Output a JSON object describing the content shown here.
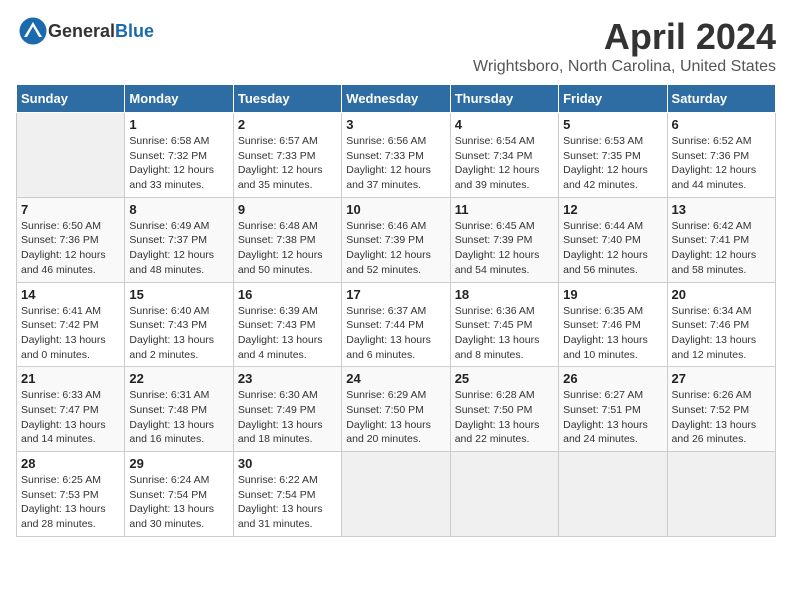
{
  "logo": {
    "general": "General",
    "blue": "Blue"
  },
  "header": {
    "month": "April 2024",
    "location": "Wrightsboro, North Carolina, United States"
  },
  "days_of_week": [
    "Sunday",
    "Monday",
    "Tuesday",
    "Wednesday",
    "Thursday",
    "Friday",
    "Saturday"
  ],
  "weeks": [
    [
      {
        "day": "",
        "info": ""
      },
      {
        "day": "1",
        "info": "Sunrise: 6:58 AM\nSunset: 7:32 PM\nDaylight: 12 hours\nand 33 minutes."
      },
      {
        "day": "2",
        "info": "Sunrise: 6:57 AM\nSunset: 7:33 PM\nDaylight: 12 hours\nand 35 minutes."
      },
      {
        "day": "3",
        "info": "Sunrise: 6:56 AM\nSunset: 7:33 PM\nDaylight: 12 hours\nand 37 minutes."
      },
      {
        "day": "4",
        "info": "Sunrise: 6:54 AM\nSunset: 7:34 PM\nDaylight: 12 hours\nand 39 minutes."
      },
      {
        "day": "5",
        "info": "Sunrise: 6:53 AM\nSunset: 7:35 PM\nDaylight: 12 hours\nand 42 minutes."
      },
      {
        "day": "6",
        "info": "Sunrise: 6:52 AM\nSunset: 7:36 PM\nDaylight: 12 hours\nand 44 minutes."
      }
    ],
    [
      {
        "day": "7",
        "info": "Sunrise: 6:50 AM\nSunset: 7:36 PM\nDaylight: 12 hours\nand 46 minutes."
      },
      {
        "day": "8",
        "info": "Sunrise: 6:49 AM\nSunset: 7:37 PM\nDaylight: 12 hours\nand 48 minutes."
      },
      {
        "day": "9",
        "info": "Sunrise: 6:48 AM\nSunset: 7:38 PM\nDaylight: 12 hours\nand 50 minutes."
      },
      {
        "day": "10",
        "info": "Sunrise: 6:46 AM\nSunset: 7:39 PM\nDaylight: 12 hours\nand 52 minutes."
      },
      {
        "day": "11",
        "info": "Sunrise: 6:45 AM\nSunset: 7:39 PM\nDaylight: 12 hours\nand 54 minutes."
      },
      {
        "day": "12",
        "info": "Sunrise: 6:44 AM\nSunset: 7:40 PM\nDaylight: 12 hours\nand 56 minutes."
      },
      {
        "day": "13",
        "info": "Sunrise: 6:42 AM\nSunset: 7:41 PM\nDaylight: 12 hours\nand 58 minutes."
      }
    ],
    [
      {
        "day": "14",
        "info": "Sunrise: 6:41 AM\nSunset: 7:42 PM\nDaylight: 13 hours\nand 0 minutes."
      },
      {
        "day": "15",
        "info": "Sunrise: 6:40 AM\nSunset: 7:43 PM\nDaylight: 13 hours\nand 2 minutes."
      },
      {
        "day": "16",
        "info": "Sunrise: 6:39 AM\nSunset: 7:43 PM\nDaylight: 13 hours\nand 4 minutes."
      },
      {
        "day": "17",
        "info": "Sunrise: 6:37 AM\nSunset: 7:44 PM\nDaylight: 13 hours\nand 6 minutes."
      },
      {
        "day": "18",
        "info": "Sunrise: 6:36 AM\nSunset: 7:45 PM\nDaylight: 13 hours\nand 8 minutes."
      },
      {
        "day": "19",
        "info": "Sunrise: 6:35 AM\nSunset: 7:46 PM\nDaylight: 13 hours\nand 10 minutes."
      },
      {
        "day": "20",
        "info": "Sunrise: 6:34 AM\nSunset: 7:46 PM\nDaylight: 13 hours\nand 12 minutes."
      }
    ],
    [
      {
        "day": "21",
        "info": "Sunrise: 6:33 AM\nSunset: 7:47 PM\nDaylight: 13 hours\nand 14 minutes."
      },
      {
        "day": "22",
        "info": "Sunrise: 6:31 AM\nSunset: 7:48 PM\nDaylight: 13 hours\nand 16 minutes."
      },
      {
        "day": "23",
        "info": "Sunrise: 6:30 AM\nSunset: 7:49 PM\nDaylight: 13 hours\nand 18 minutes."
      },
      {
        "day": "24",
        "info": "Sunrise: 6:29 AM\nSunset: 7:50 PM\nDaylight: 13 hours\nand 20 minutes."
      },
      {
        "day": "25",
        "info": "Sunrise: 6:28 AM\nSunset: 7:50 PM\nDaylight: 13 hours\nand 22 minutes."
      },
      {
        "day": "26",
        "info": "Sunrise: 6:27 AM\nSunset: 7:51 PM\nDaylight: 13 hours\nand 24 minutes."
      },
      {
        "day": "27",
        "info": "Sunrise: 6:26 AM\nSunset: 7:52 PM\nDaylight: 13 hours\nand 26 minutes."
      }
    ],
    [
      {
        "day": "28",
        "info": "Sunrise: 6:25 AM\nSunset: 7:53 PM\nDaylight: 13 hours\nand 28 minutes."
      },
      {
        "day": "29",
        "info": "Sunrise: 6:24 AM\nSunset: 7:54 PM\nDaylight: 13 hours\nand 30 minutes."
      },
      {
        "day": "30",
        "info": "Sunrise: 6:22 AM\nSunset: 7:54 PM\nDaylight: 13 hours\nand 31 minutes."
      },
      {
        "day": "",
        "info": ""
      },
      {
        "day": "",
        "info": ""
      },
      {
        "day": "",
        "info": ""
      },
      {
        "day": "",
        "info": ""
      }
    ]
  ]
}
